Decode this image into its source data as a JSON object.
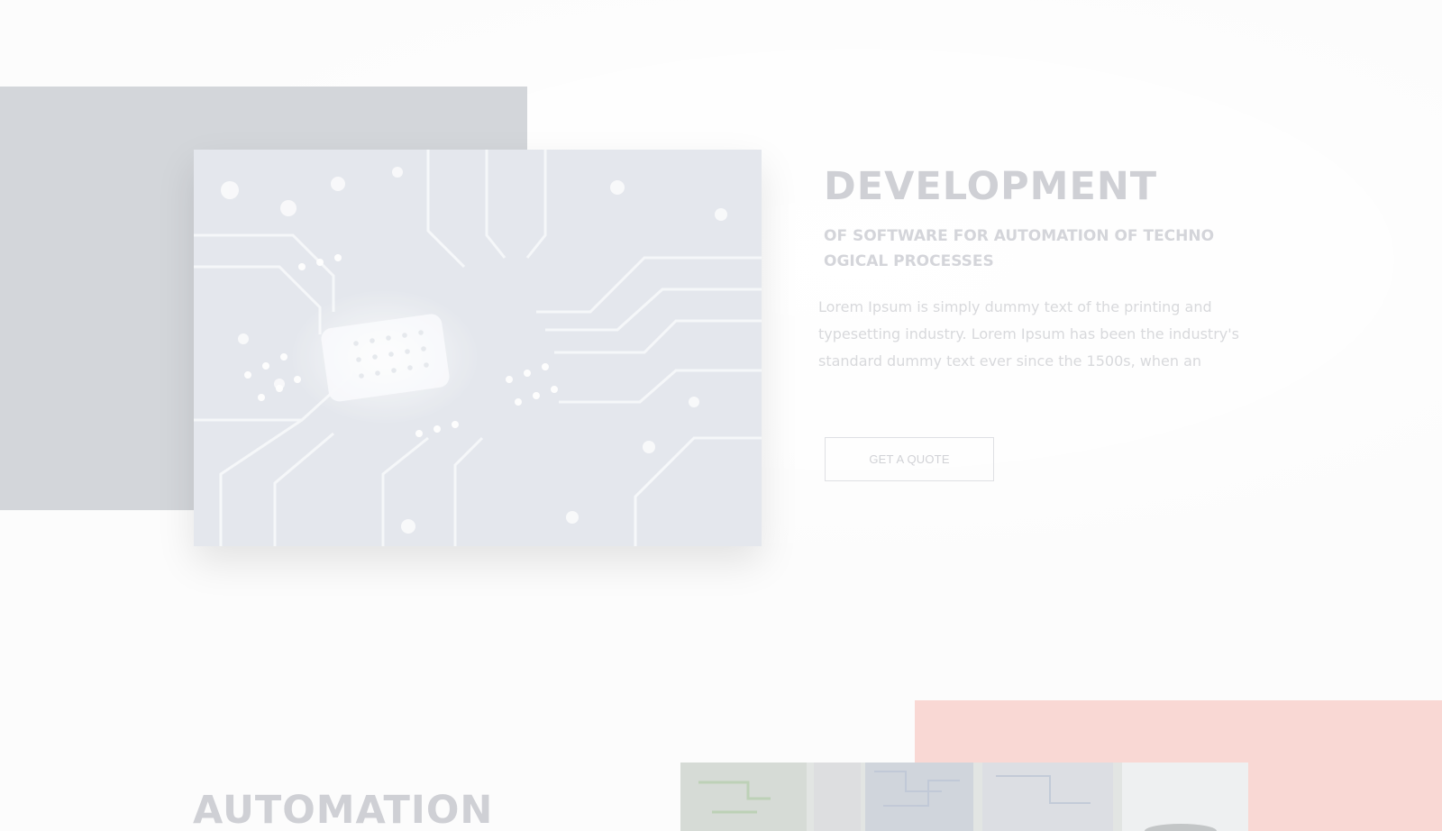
{
  "sections": {
    "development": {
      "title": "DEVELOPMENT",
      "subtitle_line1": "OF SOFTWARE FOR AUTOMATION OF TECHNO",
      "subtitle_line2": "OGICAL PROCESSES",
      "body_line1": "Lorem Ipsum is simply dummy text of the printing and",
      "body_line2": "typesetting industry. Lorem Ipsum has been the industry's",
      "body_line3": "standard dummy text ever since the 1500s, when an",
      "button_label": "GET A QUOTE"
    },
    "automation": {
      "title": "AUTOMATION"
    }
  },
  "colors": {
    "background": "#fcfcfc",
    "gray_block": "#d3d6da",
    "pink_block": "#f9d8d4",
    "title_text": "#cfd0d5",
    "body_text": "#d8d9dc",
    "button_border": "#dfe0e4"
  },
  "icons": {
    "circuit_image": "circuit-board-image",
    "automation_image": "automation-screen-image"
  }
}
